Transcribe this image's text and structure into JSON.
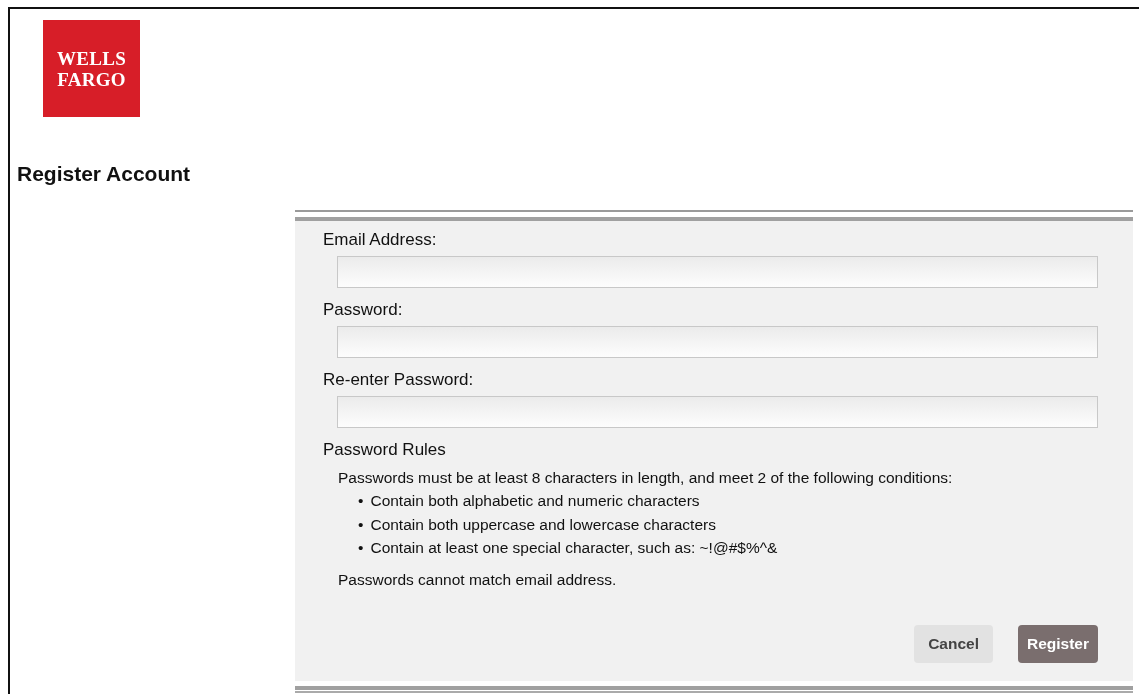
{
  "logo": {
    "lines": [
      "WELLS",
      "FARGO"
    ]
  },
  "title": "Register Account",
  "fields": [
    {
      "label": "Email Address:"
    },
    {
      "label": "Password:"
    },
    {
      "label": "Re-enter Password:"
    }
  ],
  "rules": {
    "heading": "Password Rules",
    "intro": "Passwords must be at least 8 characters in length, and meet 2 of the following conditions:",
    "items": [
      {
        "marker": "•",
        "text": "Contain both alphabetic and numeric characters"
      },
      {
        "marker": "•",
        "text": "Contain both uppercase and lowercase characters"
      },
      {
        "marker": "•",
        "text": "Contain at least one special character, such as: ~!@#$%^&"
      }
    ],
    "note": "Passwords cannot match email address."
  },
  "buttons": [
    {
      "label": "Cancel",
      "kind": "secondary"
    },
    {
      "label": "Register",
      "kind": "primary"
    }
  ]
}
